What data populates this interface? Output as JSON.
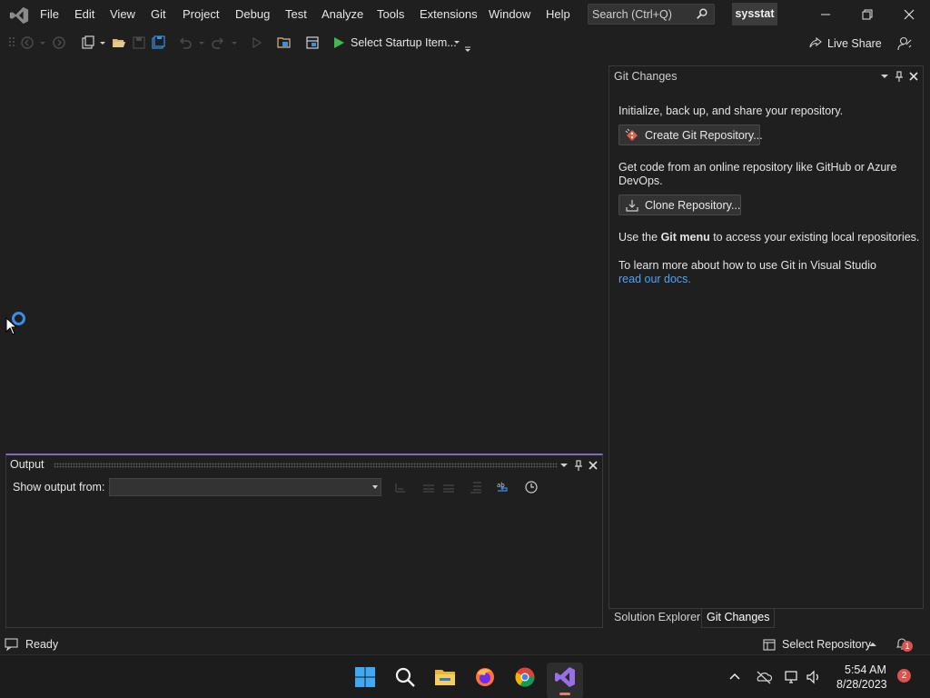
{
  "menu": {
    "items": [
      "File",
      "Edit",
      "View",
      "Git",
      "Project",
      "Debug",
      "Test",
      "Analyze",
      "Tools",
      "Extensions",
      "Window",
      "Help"
    ]
  },
  "search": {
    "label": "Search (Ctrl+Q)"
  },
  "solution_name": "sysstat",
  "toolbar": {
    "startup_label": "Select Startup Item...",
    "live_share_label": "Live Share"
  },
  "git_panel": {
    "title": "Git Changes",
    "intro": "Initialize, back up, and share your repository.",
    "create_repo_label": "Create Git Repository...",
    "get_code_text": "Get code from an online repository like GitHub or Azure DevOps.",
    "clone_repo_label": "Clone Repository...",
    "git_menu_prefix": "Use the ",
    "git_menu_bold": "Git menu",
    "git_menu_suffix": " to access your existing local repositories.",
    "learn_more": "To learn more about how to use Git in Visual Studio",
    "docs_link": "read our docs."
  },
  "panel_tabs": [
    "Solution Explorer",
    "Git Changes"
  ],
  "output": {
    "title": "Output",
    "show_from_label": "Show output from:",
    "selected_source": ""
  },
  "status": {
    "text": "Ready",
    "select_repo_label": "Select Repository",
    "notification_count": "1"
  },
  "taskbar": {
    "apps": [
      "windows-start-icon",
      "search-icon",
      "file-explorer-icon",
      "firefox-icon",
      "chrome-icon",
      "visual-studio-icon"
    ],
    "time": "5:54 AM",
    "date": "8/28/2023",
    "notification_count": "2"
  },
  "colors": {
    "accent": "#8766c5",
    "link": "#4ea4f2",
    "background": "#1f1f1f"
  }
}
